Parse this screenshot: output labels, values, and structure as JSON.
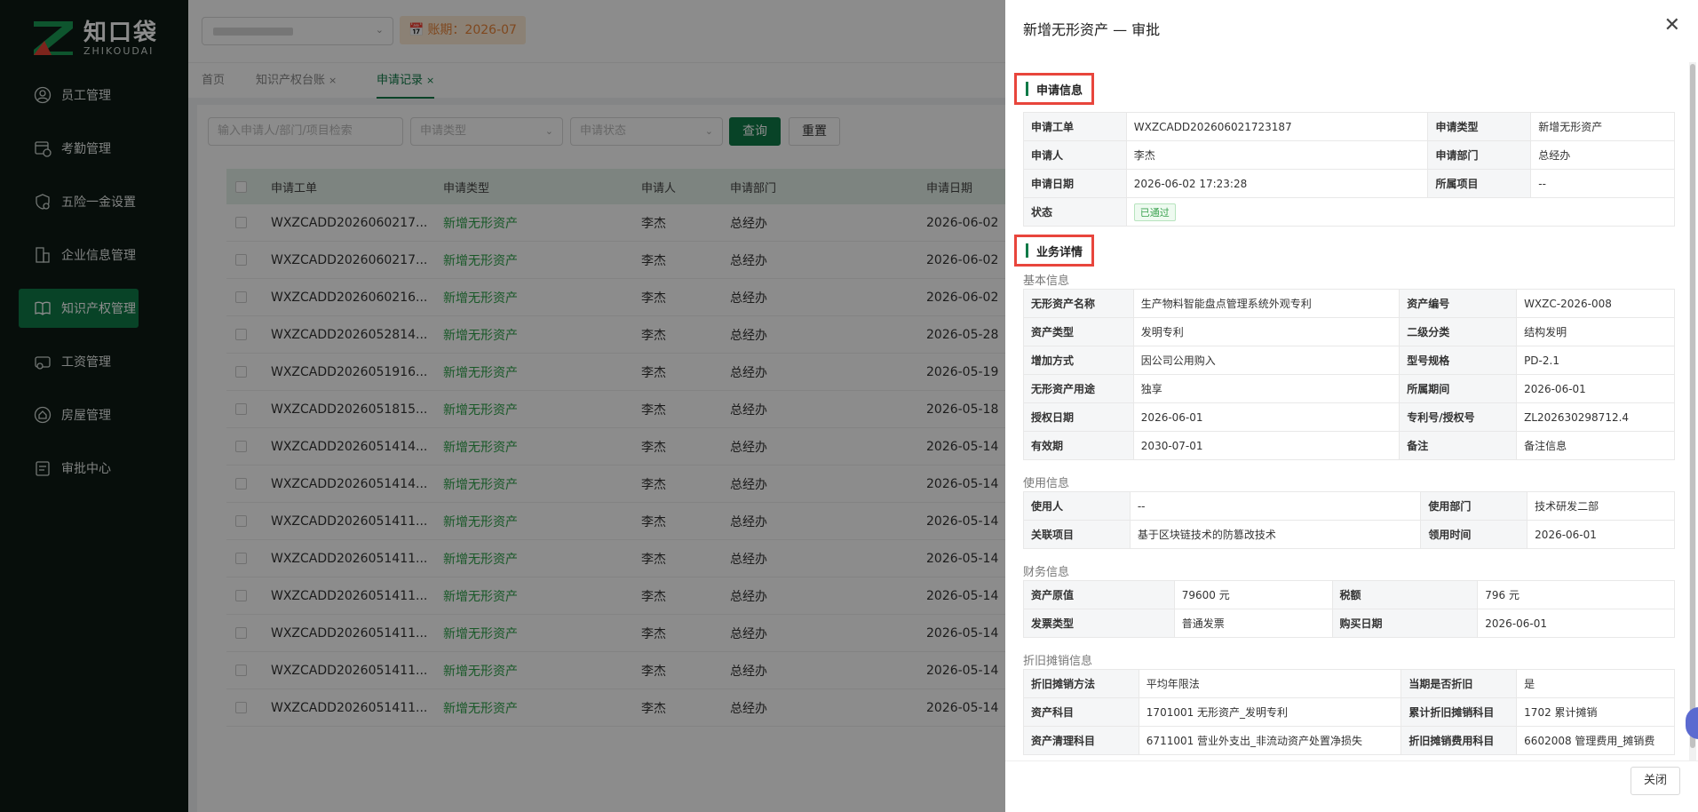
{
  "brand": {
    "cn": "知口袋",
    "en": "ZHIKOUDAI"
  },
  "sidebar": {
    "items": [
      {
        "label": "员工管理",
        "icon": "user-icon"
      },
      {
        "label": "考勤管理",
        "icon": "calendar-clock-icon"
      },
      {
        "label": "五险一金设置",
        "icon": "shield-gear-icon"
      },
      {
        "label": "企业信息管理",
        "icon": "building-icon"
      },
      {
        "label": "知识产权管理",
        "icon": "book-icon",
        "active": true
      },
      {
        "label": "工资管理",
        "icon": "wallet-icon"
      },
      {
        "label": "房屋管理",
        "icon": "house-icon"
      },
      {
        "label": "审批中心",
        "icon": "approval-icon"
      }
    ]
  },
  "topbar": {
    "period": "账期：2026-07"
  },
  "tabs": [
    {
      "label": "首页"
    },
    {
      "label": "知识产权台账"
    },
    {
      "label": "申请记录"
    }
  ],
  "filters": {
    "search_placeholder": "输入申请人/部门/项目检索",
    "type_placeholder": "申请类型",
    "status_placeholder": "申请状态",
    "query": "查询",
    "reset": "重置"
  },
  "table": {
    "headers": [
      "申请工单",
      "申请类型",
      "申请人",
      "申请部门",
      "申请日期"
    ],
    "rows": [
      [
        "WXZCADD2026060217...",
        "新增无形资产",
        "李杰",
        "总经办",
        "2026-06-02"
      ],
      [
        "WXZCADD2026060217...",
        "新增无形资产",
        "李杰",
        "总经办",
        "2026-06-02"
      ],
      [
        "WXZCADD2026060216...",
        "新增无形资产",
        "李杰",
        "总经办",
        "2026-06-02"
      ],
      [
        "WXZCADD2026052814...",
        "新增无形资产",
        "李杰",
        "总经办",
        "2026-05-28"
      ],
      [
        "WXZCADD2026051916...",
        "新增无形资产",
        "李杰",
        "总经办",
        "2026-05-19"
      ],
      [
        "WXZCADD2026051815...",
        "新增无形资产",
        "李杰",
        "总经办",
        "2026-05-18"
      ],
      [
        "WXZCADD2026051414...",
        "新增无形资产",
        "李杰",
        "总经办",
        "2026-05-14"
      ],
      [
        "WXZCADD2026051414...",
        "新增无形资产",
        "李杰",
        "总经办",
        "2026-05-14"
      ],
      [
        "WXZCADD2026051411...",
        "新增无形资产",
        "李杰",
        "总经办",
        "2026-05-14"
      ],
      [
        "WXZCADD2026051411...",
        "新增无形资产",
        "李杰",
        "总经办",
        "2026-05-14"
      ],
      [
        "WXZCADD2026051411...",
        "新增无形资产",
        "李杰",
        "总经办",
        "2026-05-14"
      ],
      [
        "WXZCADD2026051411...",
        "新增无形资产",
        "李杰",
        "总经办",
        "2026-05-14"
      ],
      [
        "WXZCADD2026051411...",
        "新增无形资产",
        "李杰",
        "总经办",
        "2026-05-14"
      ],
      [
        "WXZCADD2026051411...",
        "新增无形资产",
        "李杰",
        "总经办",
        "2026-05-14"
      ]
    ]
  },
  "drawer": {
    "title": "新增无形资产 — 审批",
    "close_label": "关闭",
    "apply": {
      "section_title": "申请信息",
      "rows": [
        [
          "申请工单",
          "WXZCADD202606021723187",
          "申请类型",
          "新增无形资产"
        ],
        [
          "申请人",
          "李杰",
          "申请部门",
          "总经办"
        ],
        [
          "申请日期",
          "2026-06-02 17:23:28",
          "所属项目",
          "--"
        ]
      ],
      "status_label": "状态",
      "status_value": "已通过"
    },
    "detail": {
      "section_title": "业务详情",
      "basic": {
        "title": "基本信息",
        "rows": [
          [
            "无形资产名称",
            "生产物料智能盘点管理系统外观专利",
            "资产编号",
            "WXZC-2026-008"
          ],
          [
            "资产类型",
            "发明专利",
            "二级分类",
            "结构发明"
          ],
          [
            "增加方式",
            "因公司公用购入",
            "型号规格",
            "PD-2.1"
          ],
          [
            "无形资产用途",
            "独享",
            "所属期间",
            "2026-06-01"
          ],
          [
            "授权日期",
            "2026-06-01",
            "专利号/授权号",
            "ZL202630298712.4"
          ],
          [
            "有效期",
            "2030-07-01",
            "备注",
            "备注信息"
          ]
        ]
      },
      "usage": {
        "title": "使用信息",
        "rows": [
          [
            "使用人",
            "--",
            "使用部门",
            "技术研发二部"
          ],
          [
            "关联项目",
            "基于区块链技术的防篡改技术",
            "领用时间",
            "2026-06-01"
          ]
        ]
      },
      "finance": {
        "title": "财务信息",
        "rows": [
          [
            "资产原值",
            "79600 元",
            "税额",
            "796 元"
          ],
          [
            "发票类型",
            "普通发票",
            "购买日期",
            "2026-06-01"
          ]
        ]
      },
      "depreciation": {
        "title": "折旧摊销信息",
        "rows": [
          [
            "折旧摊销方法",
            "平均年限法",
            "当期是否折旧",
            "是"
          ],
          [
            "资产科目",
            "1701001 无形资产_发明专利",
            "累计折旧摊销科目",
            "1702 累计摊销"
          ],
          [
            "资产清理科目",
            "6711001 营业外支出_非流动资产处置净损失",
            "折旧摊销费用科目",
            "6602008 管理费用_摊销费"
          ]
        ]
      }
    }
  }
}
